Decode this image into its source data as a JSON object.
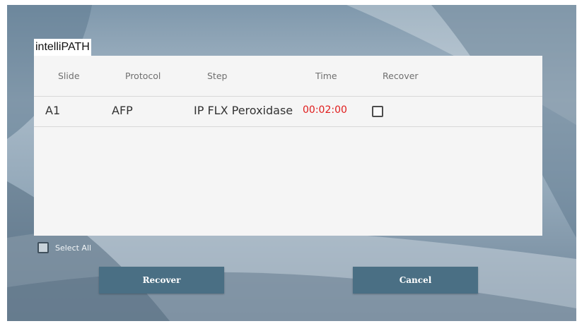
{
  "app": {
    "title": "intelliPATH"
  },
  "table": {
    "columns": [
      "Slide",
      "Protocol",
      "Step",
      "Time",
      "Recover"
    ],
    "rows": [
      {
        "slide": "A1",
        "protocol": "AFP",
        "step": "IP FLX Peroxidase",
        "time": "00:02:00",
        "recover_checked": false
      }
    ]
  },
  "select_all": {
    "label": "Select All",
    "checked": false
  },
  "buttons": {
    "recover_label": "Recover",
    "cancel_label": "Cancel"
  },
  "colors": {
    "time_text": "#e01b1b",
    "button_bg": "#4a6f84",
    "panel_bg": "#f5f5f5"
  }
}
